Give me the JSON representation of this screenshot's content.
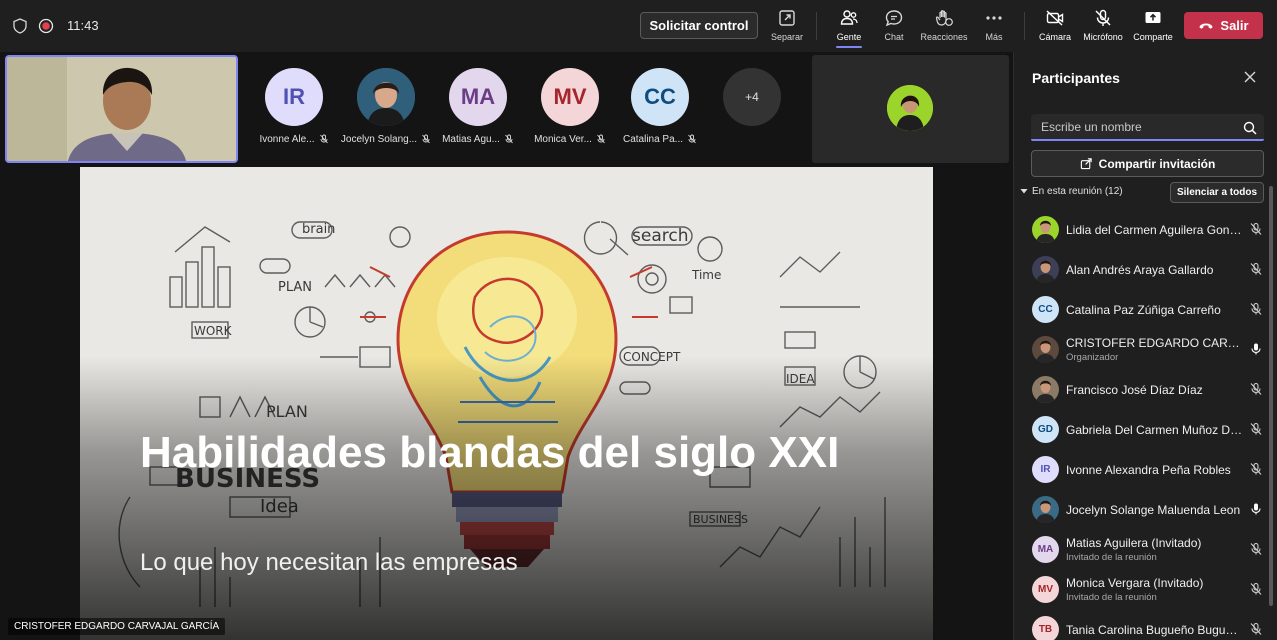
{
  "topbar": {
    "time": "11:43",
    "request_control": "Solicitar control",
    "tools": {
      "separate": "Separar",
      "people": "Gente",
      "chat": "Chat",
      "reactions": "Reacciones",
      "more": "Más",
      "camera": "Cámara",
      "mic": "Micrófono",
      "share": "Comparte"
    },
    "leave": "Salir",
    "leave_color": "#c4314b",
    "accent_color": "#7f85f5"
  },
  "gallery": {
    "tiles": [
      {
        "initials": "IR",
        "name": "Ivonne Ale...",
        "bg": "#e0dcfb",
        "fg": "#4f52b2"
      },
      {
        "initials": "",
        "name": "Jocelyn Solang...",
        "bg": "#3a6a86",
        "fg": "#ffffff",
        "photo": true
      },
      {
        "initials": "MA",
        "name": "Matias Agu...",
        "bg": "#e3d7ee",
        "fg": "#6b3d86"
      },
      {
        "initials": "MV",
        "name": "Monica Ver...",
        "bg": "#f4d5d8",
        "fg": "#a4262c"
      },
      {
        "initials": "CC",
        "name": "Catalina Pa...",
        "bg": "#d0e4f7",
        "fg": "#0f4c81"
      }
    ],
    "more": "+4"
  },
  "slide": {
    "title": "Habilidades blandas del siglo XXI",
    "subtitle": "Lo que hoy necesitan las empresas",
    "presenter": "CRISTOFER EDGARDO CARVAJAL GARCÍA"
  },
  "panel": {
    "title": "Participantes",
    "search_placeholder": "Escribe un nombre",
    "invite": "Compartir invitación",
    "section": "En esta reunión (12)",
    "mute_all": "Silenciar a todos",
    "participants": [
      {
        "name": "Lidia del Carmen Aguilera Gonza...",
        "sub": "",
        "initials": "",
        "bg": "#9bd42a",
        "fg": "#ffffff",
        "mic": "muted",
        "photo": true
      },
      {
        "name": "Alan Andrés Araya Gallardo",
        "sub": "",
        "initials": "",
        "bg": "#3c3f55",
        "fg": "#ffffff",
        "mic": "muted",
        "photo": true
      },
      {
        "name": "Catalina Paz Zúñiga Carreño",
        "sub": "",
        "initials": "CC",
        "bg": "#d0e4f7",
        "fg": "#0f4c81",
        "mic": "muted"
      },
      {
        "name": "CRISTOFER EDGARDO CARVAJA...",
        "sub": "Organizador",
        "initials": "",
        "bg": "#5c4a3e",
        "fg": "#ffffff",
        "mic": "on",
        "photo": true
      },
      {
        "name": "Francisco José Díaz Díaz",
        "sub": "",
        "initials": "",
        "bg": "#8a7a66",
        "fg": "#ffffff",
        "mic": "muted",
        "photo": true
      },
      {
        "name": "Gabriela Del Carmen Muñoz Díaz",
        "sub": "",
        "initials": "GD",
        "bg": "#d0e4f7",
        "fg": "#0f4c81",
        "mic": "muted"
      },
      {
        "name": "Ivonne Alexandra Peña Robles",
        "sub": "",
        "initials": "IR",
        "bg": "#e0dcfb",
        "fg": "#4f52b2",
        "mic": "muted"
      },
      {
        "name": "Jocelyn Solange Maluenda Leon",
        "sub": "",
        "initials": "",
        "bg": "#3a6a86",
        "fg": "#ffffff",
        "mic": "on",
        "photo": true
      },
      {
        "name": "Matias Aguilera (Invitado)",
        "sub": "Invitado de la reunión",
        "initials": "MA",
        "bg": "#e3d7ee",
        "fg": "#6b3d86",
        "mic": "muted"
      },
      {
        "name": "Monica Vergara (Invitado)",
        "sub": "Invitado de la reunión",
        "initials": "MV",
        "bg": "#f4d5d8",
        "fg": "#a4262c",
        "mic": "muted"
      },
      {
        "name": "Tania Carolina Bugueño Bugueño",
        "sub": "",
        "initials": "TB",
        "bg": "#f4d5d8",
        "fg": "#a4262c",
        "mic": "muted"
      }
    ]
  }
}
